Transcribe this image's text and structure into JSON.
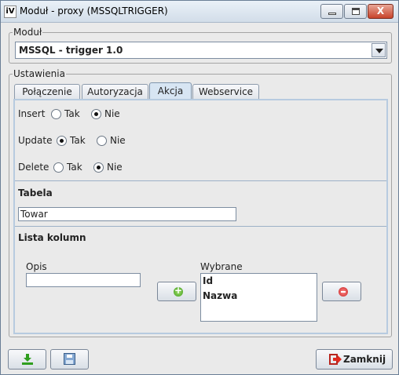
{
  "window": {
    "title": "Moduł - proxy (MSSQLTRIGGER)",
    "app_icon_text": "iV",
    "close_glyph": "X"
  },
  "module_group": {
    "legend": "Moduł",
    "selected": "MSSQL - trigger 1.0"
  },
  "settings_group": {
    "legend": "Ustawienia",
    "tabs": [
      {
        "label": "Połączenie"
      },
      {
        "label": "Autoryzacja"
      },
      {
        "label": "Akcja"
      },
      {
        "label": "Webservice"
      }
    ],
    "active_tab": "Akcja"
  },
  "actions": {
    "insert": {
      "label": "Insert",
      "yes": "Tak",
      "no": "Nie",
      "selected": "Nie"
    },
    "update": {
      "label": "Update",
      "yes": "Tak",
      "no": "Nie",
      "selected": "Tak"
    },
    "delete": {
      "label": "Delete",
      "yes": "Tak",
      "no": "Nie",
      "selected": "Nie"
    }
  },
  "table": {
    "label": "Tabela",
    "value": "Towar"
  },
  "columns": {
    "label": "Lista kolumn",
    "opis_label": "Opis",
    "opis_value": "",
    "selected_label": "Wybrane",
    "selected_items": [
      "Id",
      "Nazwa"
    ]
  },
  "footer": {
    "close_label": "Zamknij"
  },
  "icons": {
    "download": "download-icon",
    "save": "save-icon",
    "add": "plus-icon",
    "remove": "minus-icon",
    "exit": "exit-icon"
  },
  "colors": {
    "accent": "#d7e5f3",
    "add": "#3f9a1b",
    "remove": "#c91f1f"
  }
}
